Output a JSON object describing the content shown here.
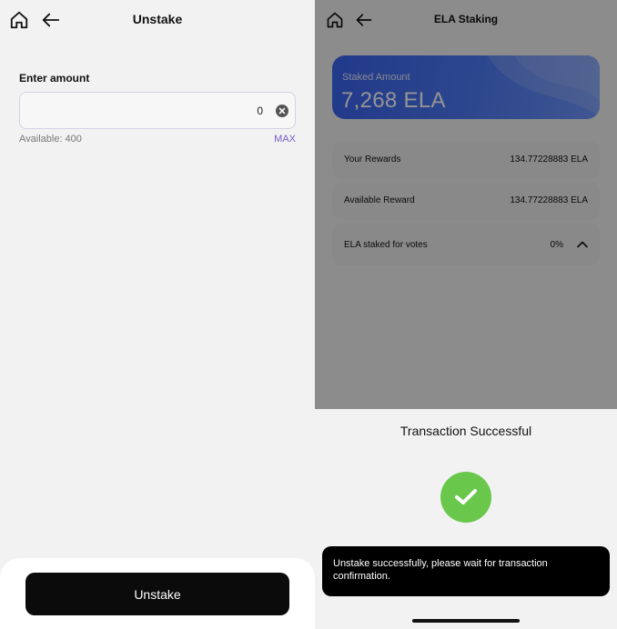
{
  "unstake_screen": {
    "title": "Unstake",
    "amount_label": "Enter amount",
    "amount_value": "0",
    "available": "Available: 400",
    "max_label": "MAX",
    "unstake_button": "Unstake"
  },
  "staking_screen": {
    "title": "ELA Staking",
    "staked_label": "Staked Amount",
    "staked_value": "7,268 ELA",
    "rows": [
      {
        "label": "Your Rewards",
        "value": "134.77228883 ELA"
      },
      {
        "label": "Available Reward",
        "value": "134.77228883 ELA"
      },
      {
        "label": "ELA staked for votes",
        "value": "0%"
      }
    ]
  },
  "transaction_sheet": {
    "title": "Transaction Successful"
  },
  "toast": {
    "message": "Unstake successfully, please wait for transaction confirmation."
  },
  "colors": {
    "accent": "#7a5cc7",
    "card_blue": "#4469f0",
    "success_green": "#69c84c",
    "primary_button": "#0b0b0b"
  },
  "icons": {
    "home": "home-icon",
    "back": "arrow-left-icon",
    "clear": "clear-circle-icon",
    "collapse": "chevron-up-icon",
    "success": "checkmark-icon"
  }
}
